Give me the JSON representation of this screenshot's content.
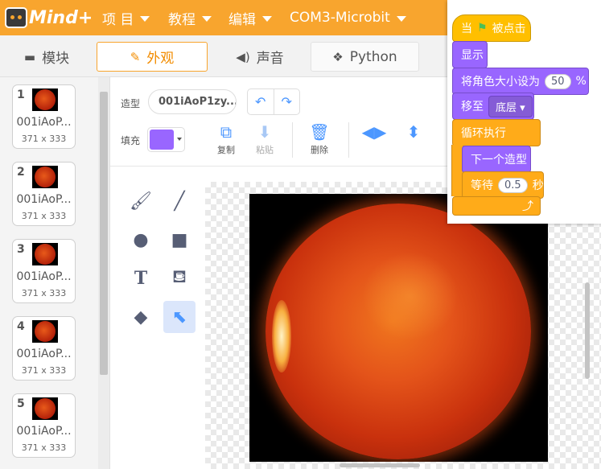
{
  "app": {
    "logo_text": "Mind+"
  },
  "menu": {
    "project": "项 目",
    "tutorial": "教程",
    "edit": "编辑",
    "device": "COM3-Microbit"
  },
  "tabs": {
    "blocks": "模块",
    "costumes": "外观",
    "sounds": "声音",
    "python": "Python"
  },
  "costumes": [
    {
      "num": "1",
      "name": "001iAoP...",
      "size": "371 x 333"
    },
    {
      "num": "2",
      "name": "001iAoP...",
      "size": "371 x 333"
    },
    {
      "num": "3",
      "name": "001iAoP...",
      "size": "371 x 333"
    },
    {
      "num": "4",
      "name": "001iAoP...",
      "size": "371 x 333"
    },
    {
      "num": "5",
      "name": "001iAoP...",
      "size": "371 x 333"
    }
  ],
  "editor": {
    "costume_label": "造型",
    "costume_name": "001iAoP1zy...",
    "fill_label": "填充",
    "fill_color": "#9966ff",
    "copy": "复制",
    "paste": "粘贴",
    "delete": "删除"
  },
  "script": {
    "when_prefix": "当",
    "when_suffix": "被点击",
    "show": "显示",
    "set_size_prefix": "将角色大小设为",
    "set_size_value": "50",
    "set_size_suffix": "%",
    "go_to_prefix": "移至",
    "go_to_value": "底层 ▾",
    "forever": "循环执行",
    "next_costume": "下一个造型",
    "wait_prefix": "等待",
    "wait_value": "0.5",
    "wait_suffix": "秒",
    "loop_arrow": "⤴"
  },
  "colors": {
    "topbar": "#f8a52e",
    "events": "#ffbf00",
    "looks": "#9966ff",
    "control": "#ffab19"
  }
}
